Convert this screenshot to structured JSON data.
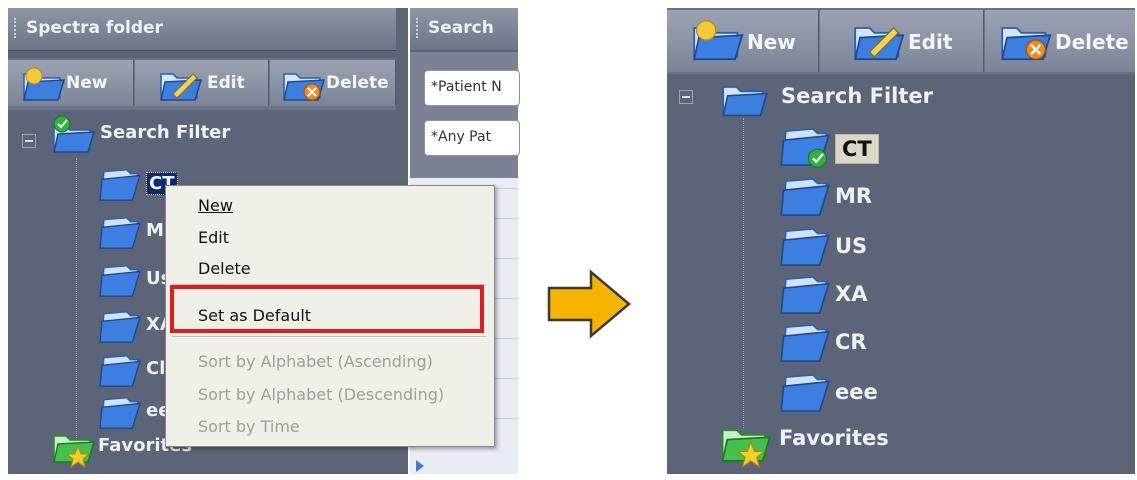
{
  "left": {
    "panel_title": "Spectra folder",
    "toolbar": {
      "new": "New",
      "edit": "Edit",
      "delete": "Delete"
    },
    "tree": {
      "root": "Search Filter",
      "items": [
        "CT",
        "MR",
        "US",
        "XA",
        "CR",
        "eee"
      ],
      "visible_items": [
        "CT",
        "M",
        "Us",
        "XA",
        "Cl",
        "ee"
      ],
      "favorites": "Favorites",
      "favorites_visible": "Favorites"
    }
  },
  "search_panel": {
    "title": "Search",
    "field1": "*Patient N",
    "field2": "*Any Pat"
  },
  "context_menu": {
    "items": [
      {
        "label": "New",
        "enabled": true
      },
      {
        "label": "Edit",
        "enabled": true
      },
      {
        "label": "Delete",
        "enabled": true
      },
      {
        "label": "Set as Default",
        "enabled": true,
        "highlighted": true
      },
      {
        "label": "Sort by Alphabet (Ascending)",
        "enabled": false
      },
      {
        "label": "Sort by Alphabet (Descending)",
        "enabled": false
      },
      {
        "label": "Sort by Time",
        "enabled": false
      }
    ]
  },
  "right": {
    "toolbar": {
      "new": "New",
      "edit": "Edit",
      "delete": "Delete"
    },
    "tree": {
      "root": "Search Filter",
      "items": [
        "CT",
        "MR",
        "US",
        "XA",
        "CR",
        "eee"
      ],
      "default_item": "CT",
      "favorites": "Favorites"
    }
  },
  "colors": {
    "panel_bg": "#5c6577",
    "highlight_border": "#e01b1b",
    "arrow_fill": "#f5b400",
    "folder_blue": "#3d7fe0",
    "check_green": "#2fb33a"
  }
}
